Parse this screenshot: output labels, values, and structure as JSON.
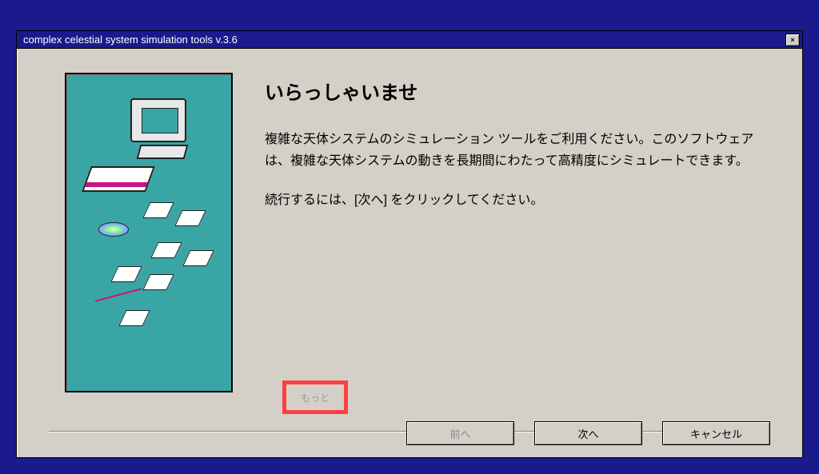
{
  "titlebar": {
    "title": "complex celestial system simulation tools v.3.6",
    "close_symbol": "×"
  },
  "wizard": {
    "heading": "いらっしゃいませ",
    "paragraph1": "複雑な天体システムのシミュレーション ツールをご利用ください。このソフトウェアは、複雑な天体システムの動きを長期間にわたって高精度にシミュレートできます。",
    "paragraph2": "続行するには、[次へ] をクリックしてください。",
    "more_label": "もっと"
  },
  "buttons": {
    "back": "前へ",
    "next": "次へ",
    "cancel": "キャンセル"
  }
}
